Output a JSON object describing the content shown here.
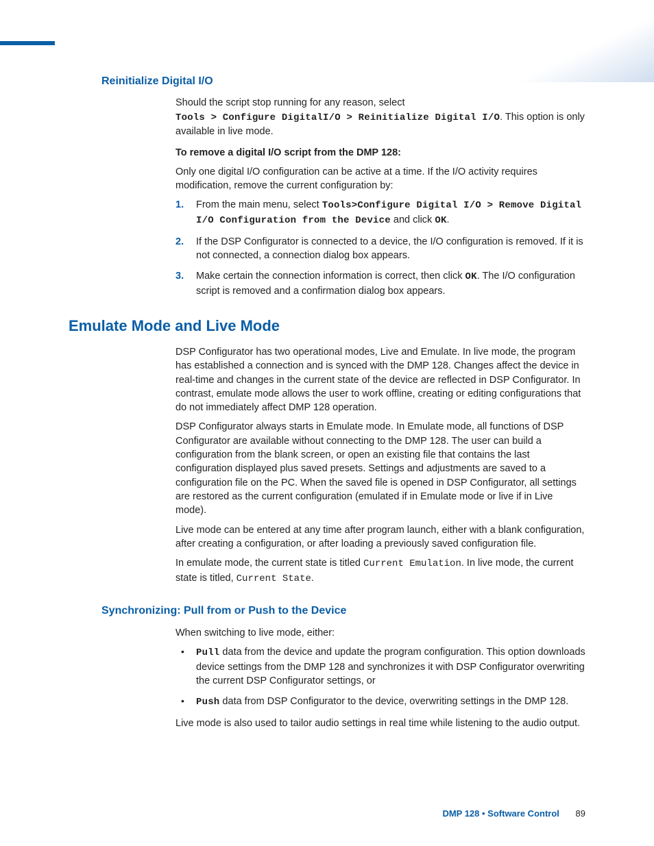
{
  "section1": {
    "heading": "Reinitialize Digital I/O",
    "p1a": "Should the script stop running for any reason, select",
    "p1b_mono": "Tools > Configure DigitalI/O > Reinitialize Digital I/O",
    "p1c": ". This option is only available in live mode.",
    "subhead": "To remove a digital I/O script from the DMP 128:",
    "p2": "Only one digital I/O configuration can be active at a time. If the I/O activity requires modification, remove the current configuration by:",
    "steps": [
      {
        "num": "1.",
        "pre": "From the main menu, select ",
        "mono": "Tools>Configure Digital I/O > Remove Digital I/O Configuration from the Device",
        "mid": " and click ",
        "mono2": "OK",
        "post": "."
      },
      {
        "num": "2.",
        "text": "If the DSP Configurator is connected to a device, the I/O configuration is removed. If it is not connected, a connection dialog box appears."
      },
      {
        "num": "3.",
        "pre": "Make certain the connection information is correct, then click ",
        "mono": "OK",
        "post": ". The I/O configuration script is removed and a confirmation dialog box appears."
      }
    ]
  },
  "section2": {
    "heading": "Emulate Mode and Live Mode",
    "p1": "DSP Configurator has two operational modes, Live and Emulate. In live mode, the program has established a connection and is synced with the DMP 128. Changes affect the device in real-time and changes in the current state of the device are reflected in DSP Configurator. In contrast, emulate mode allows the user to work offline, creating or editing configurations that do not immediately affect DMP 128 operation.",
    "p2": "DSP Configurator always starts in Emulate mode. In Emulate mode, all functions of DSP Configurator are available without connecting to the DMP 128. The user can build a configuration from the blank screen, or open an existing file that contains the last configuration displayed plus saved presets. Settings and adjustments are saved to a configuration file on the PC. When the saved file is opened in DSP Configurator, all settings are restored as the current configuration (emulated if in Emulate mode or live if in Live mode).",
    "p3": "Live mode can be entered at any time after program launch, either with a blank configuration, after creating a configuration, or after loading a previously saved configuration file.",
    "p4a": "In emulate mode, the current state is titled ",
    "p4b_mono": "Current Emulation",
    "p4c": ". In live mode, the current state is titled, ",
    "p4d_mono": "Current State",
    "p4e": "."
  },
  "section3": {
    "heading": "Synchronizing: Pull from or Push to the Device",
    "p1": "When switching to live mode, either:",
    "bullets": [
      {
        "bold": "Pull",
        "text": " data from the device and update the program configuration. This option downloads device settings from the DMP 128 and synchronizes it with DSP Configurator overwriting the current DSP Configurator settings, or"
      },
      {
        "bold": "Push",
        "text": " data from DSP Configurator to the device, overwriting settings in the DMP 128."
      }
    ],
    "p2": "Live mode is also used to tailor audio settings in real time while listening to the audio output."
  },
  "footer": {
    "title": "DMP 128 • Software Control",
    "page": "89"
  }
}
